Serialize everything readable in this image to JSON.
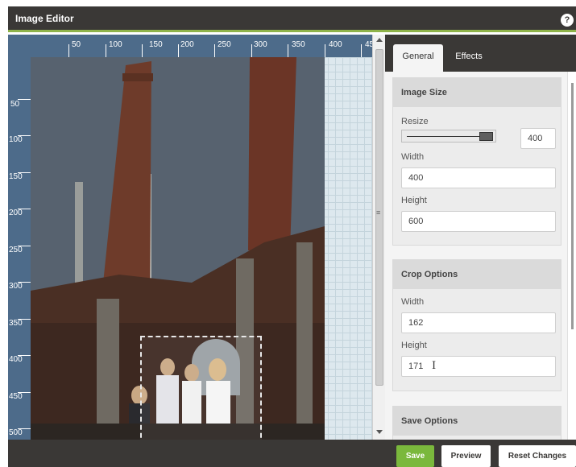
{
  "header": {
    "title": "Image Editor",
    "help_label": "?"
  },
  "canvas": {
    "ruler_top_labels": [
      "50",
      "100",
      "150",
      "200",
      "250",
      "300",
      "350",
      "400",
      "45"
    ],
    "ruler_left_labels": [
      "50",
      "100",
      "150",
      "200",
      "250",
      "300",
      "350",
      "400",
      "450",
      "500"
    ],
    "photo_icon": "building-chimneys-photo",
    "scroll_grip": "≡"
  },
  "panel": {
    "tabs": [
      {
        "label": "General",
        "active": true
      },
      {
        "label": "Effects",
        "active": false
      }
    ],
    "image_size": {
      "heading": "Image Size",
      "resize_label": "Resize",
      "resize_value": "400",
      "width_label": "Width",
      "width_value": "400",
      "height_label": "Height",
      "height_value": "600"
    },
    "crop_options": {
      "heading": "Crop Options",
      "width_label": "Width",
      "width_value": "162",
      "height_label": "Height",
      "height_value": "171",
      "cursor_glyph": "I"
    },
    "save_options": {
      "heading": "Save Options"
    }
  },
  "footer": {
    "save_label": "Save",
    "preview_label": "Preview",
    "reset_label": "Reset Changes"
  },
  "colors": {
    "titlebar": "#3a3836",
    "accent_green": "#7ab83c",
    "ruler_blue": "#4d6b8a"
  }
}
